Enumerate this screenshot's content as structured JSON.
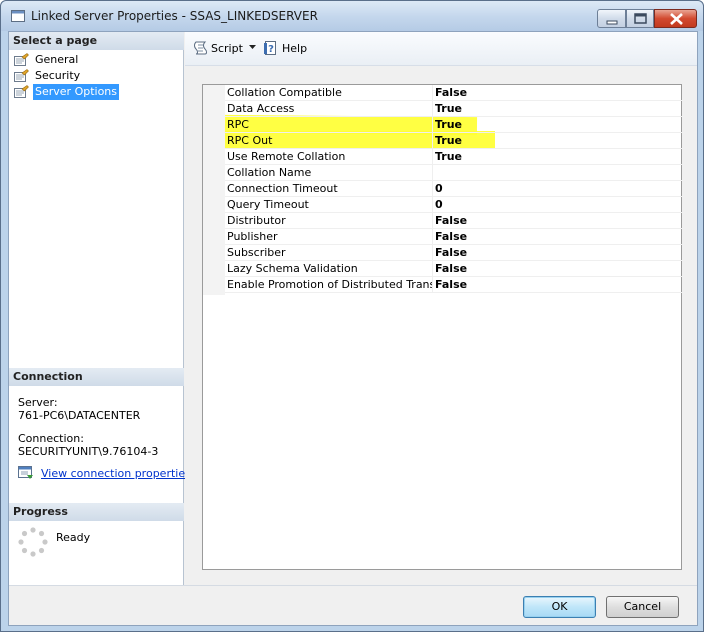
{
  "window": {
    "title": "Linked Server Properties - SSAS_LINKEDSERVER"
  },
  "left": {
    "select_page_header": "Select a page",
    "pages": [
      {
        "label": "General",
        "icon": "page-wrench-icon",
        "selected": false
      },
      {
        "label": "Security",
        "icon": "page-wrench-icon",
        "selected": false
      },
      {
        "label": "Server Options",
        "icon": "page-wrench-icon",
        "selected": true
      }
    ],
    "connection_header": "Connection",
    "server_label": "Server:",
    "server_value": "761-PC6\\DATACENTER",
    "connection_label": "Connection:",
    "connection_value": "SECURITYUNIT\\9.76104-3",
    "view_connection_link": "View connection properties",
    "progress_header": "Progress",
    "progress_status": "Ready"
  },
  "toolbar": {
    "script_label": "Script",
    "help_label": "Help"
  },
  "options": [
    {
      "name": "Collation Compatible",
      "value": "False"
    },
    {
      "name": "Data Access",
      "value": "True"
    },
    {
      "name": "RPC",
      "value": "True"
    },
    {
      "name": "RPC Out",
      "value": "True"
    },
    {
      "name": "Use Remote Collation",
      "value": "True"
    },
    {
      "name": "Collation Name",
      "value": ""
    },
    {
      "name": "Connection Timeout",
      "value": "0"
    },
    {
      "name": "Query Timeout",
      "value": "0"
    },
    {
      "name": "Distributor",
      "value": "False"
    },
    {
      "name": "Publisher",
      "value": "False"
    },
    {
      "name": "Subscriber",
      "value": "False"
    },
    {
      "name": "Lazy Schema Validation",
      "value": "False"
    },
    {
      "name": "Enable Promotion of Distributed Transactio",
      "value": "False"
    }
  ],
  "highlight_color": "#ffff33",
  "buttons": {
    "ok": "OK",
    "cancel": "Cancel"
  }
}
